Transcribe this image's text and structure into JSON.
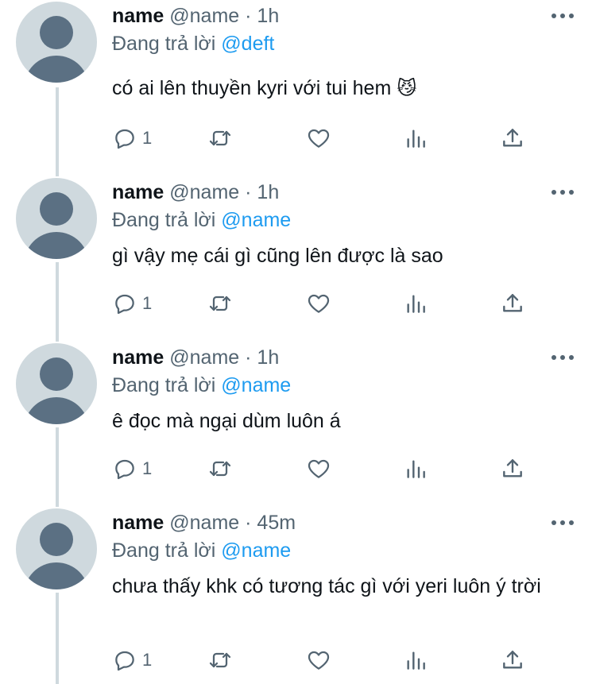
{
  "tweets": [
    {
      "name": "name",
      "handle": "@name",
      "dot": "·",
      "time": "1h",
      "replying_prefix": "Đang trả lời",
      "replying_to": "@deft",
      "text": "có ai lên thuyền kyri với tui hem",
      "emoji": "😼",
      "reply_count": "1"
    },
    {
      "name": "name",
      "handle": "@name",
      "dot": "·",
      "time": "1h",
      "replying_prefix": "Đang trả lời",
      "replying_to": "@name",
      "text": "gì vậy mẹ cái gì cũng lên được là sao",
      "emoji": "",
      "reply_count": "1"
    },
    {
      "name": "name",
      "handle": "@name",
      "dot": "·",
      "time": "1h",
      "replying_prefix": "Đang trả lời",
      "replying_to": "@name",
      "text": "ê đọc mà ngại dùm luôn á",
      "emoji": "",
      "reply_count": "1"
    },
    {
      "name": "name",
      "handle": "@name",
      "dot": "·",
      "time": "45m",
      "replying_prefix": "Đang trả lời",
      "replying_to": "@name",
      "text": "chưa thấy khk có tương tác gì với yeri luôn ý trời",
      "emoji": "",
      "reply_count": "1"
    }
  ],
  "icons": {
    "reply": "reply-icon",
    "retweet": "retweet-icon",
    "like": "heart-icon",
    "analytics": "analytics-icon",
    "share": "share-icon",
    "more": "more-icon",
    "avatar": "default-avatar-icon"
  },
  "colors": {
    "mention": "#1d9bf0",
    "secondary_text": "#536471",
    "avatar_bg": "#cfd9de",
    "avatar_fg": "#5b7083"
  }
}
